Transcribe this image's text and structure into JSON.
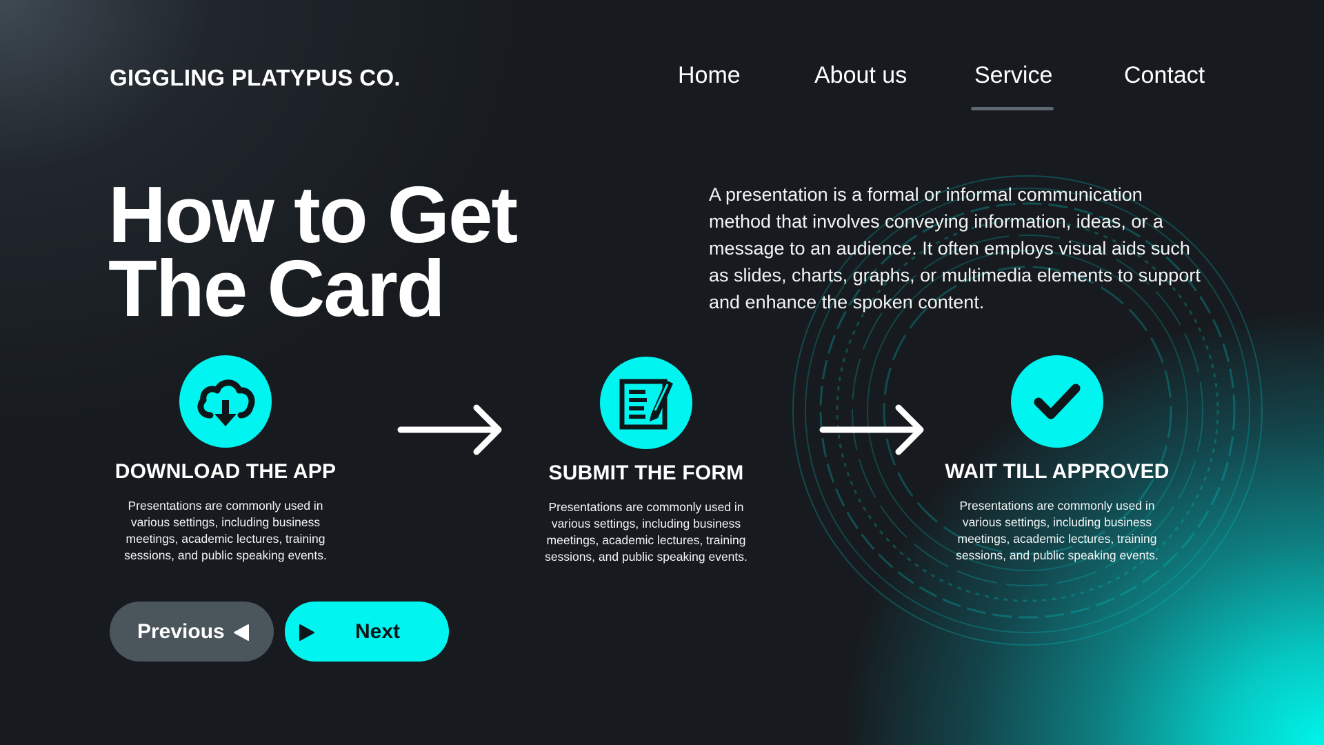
{
  "brand": "GIGGLING PLATYPUS CO.",
  "nav": {
    "items": [
      {
        "label": "Home"
      },
      {
        "label": "About us"
      },
      {
        "label": "Service"
      },
      {
        "label": "Contact"
      }
    ],
    "active": "Service"
  },
  "hero": {
    "title": "How to Get The Card",
    "description": "A presentation is a formal or informal communication method that involves conveying information, ideas, or a message to an audience. It often employs visual aids such as slides, charts, graphs, or multimedia elements to support and enhance the spoken content."
  },
  "steps": [
    {
      "icon": "cloud-download-icon",
      "title": "DOWNLOAD THE APP",
      "text": "Presentations are commonly used in various settings, including business meetings, academic lectures, training sessions, and public speaking events."
    },
    {
      "icon": "form-edit-icon",
      "title": "SUBMIT THE FORM",
      "text": "Presentations are commonly used in various settings, including business meetings, academic lectures, training sessions, and public speaking events."
    },
    {
      "icon": "checkmark-icon",
      "title": "WAIT TILL APPROVED",
      "text": "Presentations are commonly used in various settings, including business meetings, academic lectures, training sessions, and public speaking events."
    }
  ],
  "buttons": {
    "previous": "Previous",
    "next": "Next"
  },
  "colors": {
    "accent": "#00f5f0",
    "background": "#171b1f",
    "button_secondary": "#4a555c"
  }
}
